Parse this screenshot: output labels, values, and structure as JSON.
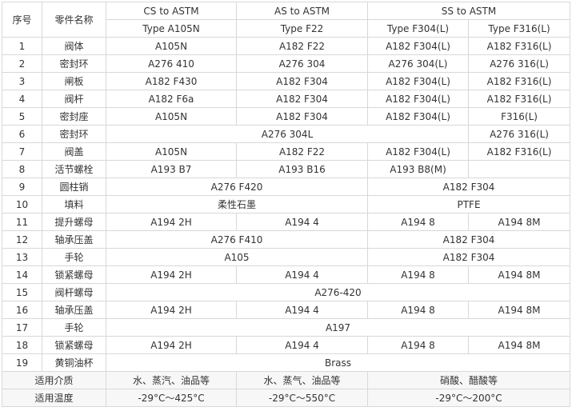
{
  "header": {
    "seq": "序号",
    "part_name": "零件名称",
    "groups": [
      "CS to ASTM",
      "AS to ASTM",
      "SS to ASTM"
    ],
    "types": [
      "Type A105N",
      "Type F22",
      "Type F304(L)",
      "Type F316(L)"
    ]
  },
  "rows": [
    {
      "no": "1",
      "name": "阀体",
      "cells": [
        "A105N",
        "A182 F22",
        "A182 F304(L)",
        "A182 F316(L)"
      ]
    },
    {
      "no": "2",
      "name": "密封环",
      "cells": [
        "A276 410",
        "A276 304",
        "A276 304(L)",
        "A276 316(L)"
      ]
    },
    {
      "no": "3",
      "name": "闸板",
      "cells": [
        "A182 F430",
        "A182 F304",
        "A182 F304(L)",
        "A182 F316(L)"
      ]
    },
    {
      "no": "4",
      "name": "阀杆",
      "cells": [
        "A182 F6a",
        "A182 F304",
        "A182 F304(L)",
        "A182 F316(L)"
      ]
    },
    {
      "no": "5",
      "name": "密封座",
      "cells": [
        "A105N",
        "A182 F304",
        "A182 F304(L)",
        "F316(L)"
      ]
    },
    {
      "no": "6",
      "name": "密封环",
      "cells": [
        "A276 304L",
        "A276 316(L)"
      ]
    },
    {
      "no": "7",
      "name": "阀盖",
      "cells": [
        "A105N",
        "A182 F22",
        "A182 F304(L)",
        "A182 F316(L)"
      ]
    },
    {
      "no": "8",
      "name": "活节螺栓",
      "cells": [
        "A193 B7",
        "A193 B16",
        "A193 B8(M)"
      ]
    },
    {
      "no": "9",
      "name": "圆柱销",
      "cells": [
        "A276 F420",
        "A182 F304"
      ]
    },
    {
      "no": "10",
      "name": "填料",
      "cells": [
        "柔性石墨",
        "PTFE"
      ]
    },
    {
      "no": "11",
      "name": "提升螺母",
      "cells": [
        "A194 2H",
        "A194 4",
        "A194 8",
        "A194 8M"
      ]
    },
    {
      "no": "12",
      "name": "轴承压盖",
      "cells": [
        "A276 F410",
        "A182 F304"
      ]
    },
    {
      "no": "13",
      "name": "手轮",
      "cells": [
        "A105",
        "A182 F304"
      ]
    },
    {
      "no": "14",
      "name": "锁紧螺母",
      "cells": [
        "A194 2H",
        "A194 4",
        "A194 8",
        "A194 8M"
      ]
    },
    {
      "no": "15",
      "name": "阀杆螺母",
      "cells": [
        "A276-420"
      ]
    },
    {
      "no": "16",
      "name": "轴承压盖",
      "cells": [
        "A194 2H",
        "A194 4",
        "A194 8",
        "A194 8M"
      ]
    },
    {
      "no": "17",
      "name": "手轮",
      "cells": [
        "A197"
      ]
    },
    {
      "no": "18",
      "name": "锁紧螺母",
      "cells": [
        "A194 2H",
        "A194 4",
        "A194 8",
        "A194 8M"
      ]
    },
    {
      "no": "19",
      "name": "黄铜油杯",
      "cells": [
        "Brass"
      ]
    }
  ],
  "footer": {
    "medium_label": "适用介质",
    "medium": [
      "水、蒸汽、油品等",
      "水、蒸气、油品等",
      "硝酸、醋酸等"
    ],
    "temp_label": "适用温度",
    "temp": [
      "-29°C～425°C",
      "-29°C～550°C",
      "-29°C～200°C"
    ]
  }
}
